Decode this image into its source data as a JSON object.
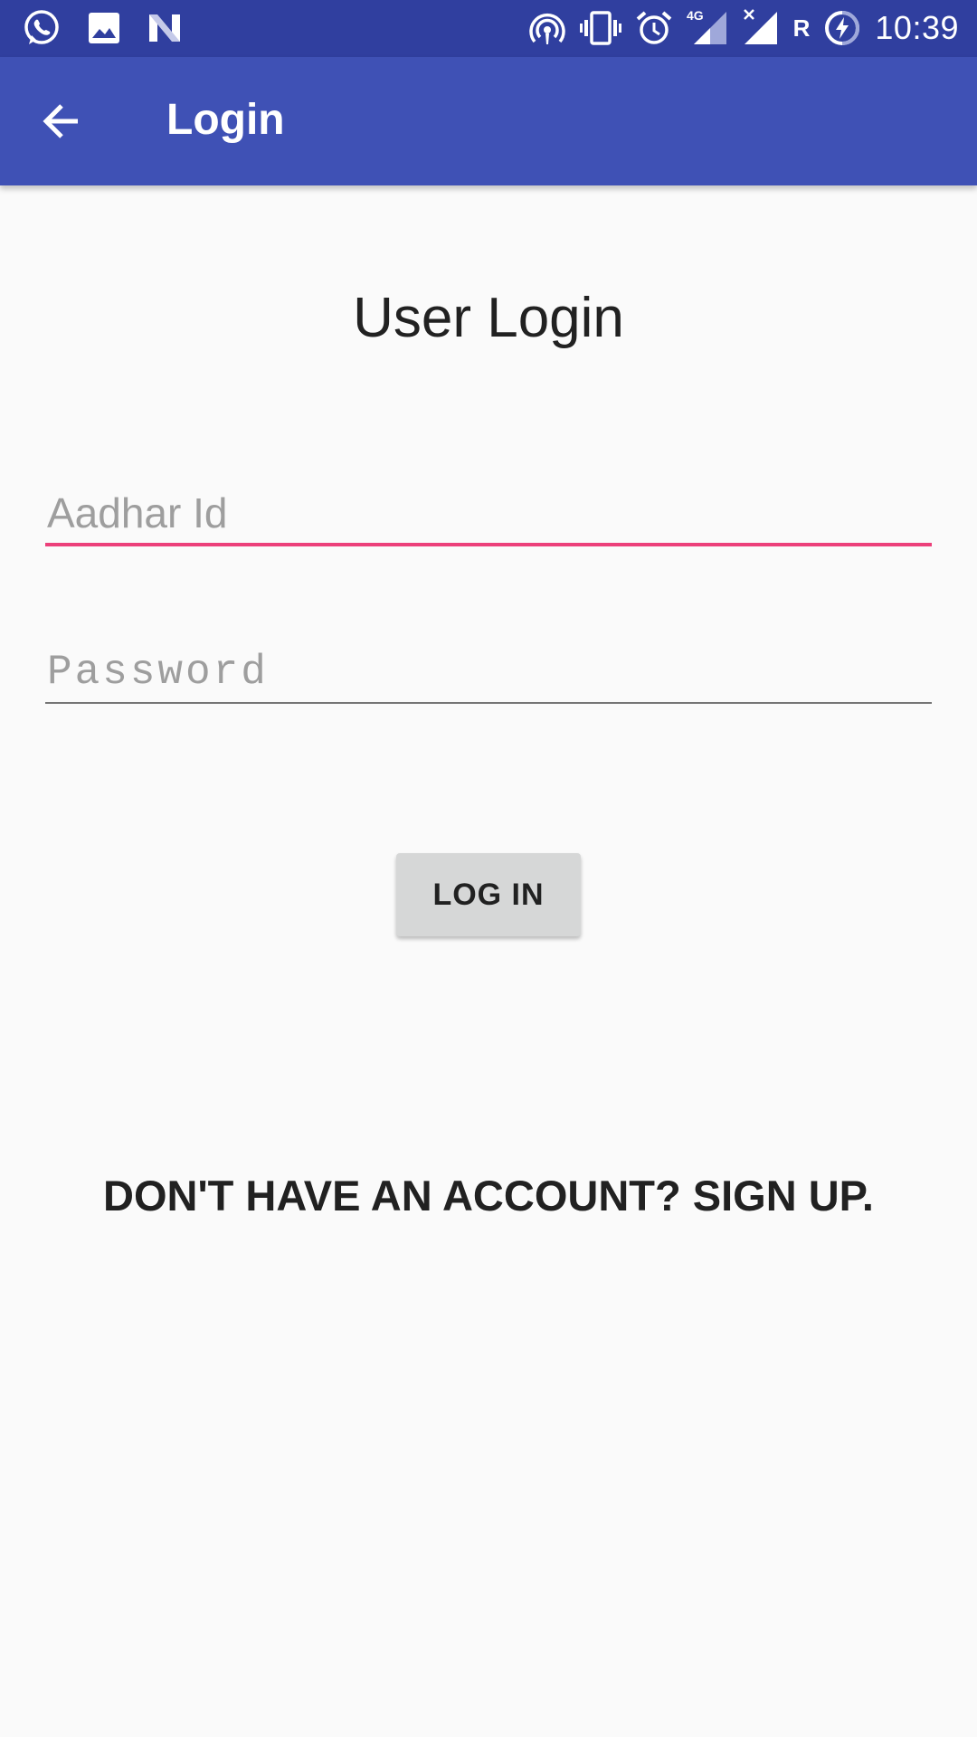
{
  "status_bar": {
    "time": "10:39",
    "network_type": "4G",
    "roaming_indicator": "R",
    "left_icons": [
      "whatsapp-icon",
      "gallery-icon",
      "n-app-icon"
    ],
    "right_icons": [
      "hotspot-icon",
      "vibrate-icon",
      "alarm-icon",
      "signal-4g-icon",
      "signal-no-service-icon",
      "roaming-indicator",
      "battery-charging-icon"
    ]
  },
  "app_bar": {
    "title": "Login",
    "back_icon": "back-arrow-icon"
  },
  "main": {
    "heading": "User Login",
    "aadhar_field": {
      "placeholder": "Aadhar Id",
      "value": ""
    },
    "password_field": {
      "placeholder": "Password",
      "value": ""
    },
    "login_button_label": "LOG IN",
    "signup_link_text": "DON'T HAVE AN ACCOUNT? SIGN UP."
  },
  "colors": {
    "status_bar": "#303f9f",
    "app_bar": "#3f51b5",
    "focused_underline": "#ec407a",
    "background": "#fafafa",
    "button": "#d6d7d7"
  }
}
